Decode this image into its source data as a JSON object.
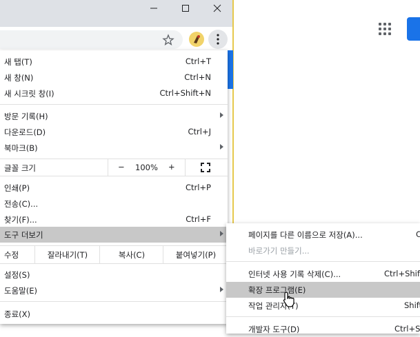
{
  "colors": {
    "accent": "#1a73e8",
    "highlight": "#c8c8c8",
    "disabled_text": "#9aa0a6"
  },
  "window": {
    "icons": [
      "minimize-icon",
      "maximize-icon",
      "close-icon"
    ]
  },
  "toolbar": {
    "icons": [
      "bookmark-star-icon",
      "extension-icon",
      "menu-kebab-icon"
    ]
  },
  "page": {
    "icons": [
      "apps-grid-icon"
    ]
  },
  "menu": {
    "new_tab": {
      "label": "새 탭(T)",
      "shortcut": "Ctrl+T"
    },
    "new_window": {
      "label": "새 창(N)",
      "shortcut": "Ctrl+N"
    },
    "incognito": {
      "label": "새 시크릿 창(I)",
      "shortcut": "Ctrl+Shift+N"
    },
    "history": {
      "label": "방문 기록(H)"
    },
    "downloads": {
      "label": "다운로드(D)",
      "shortcut": "Ctrl+J"
    },
    "bookmarks": {
      "label": "북마크(B)"
    },
    "zoom": {
      "label": "글꼴 크기",
      "minus": "−",
      "value": "100%",
      "plus": "+"
    },
    "print": {
      "label": "인쇄(P)",
      "shortcut": "Ctrl+P"
    },
    "cast": {
      "label": "전송(C)..."
    },
    "find": {
      "label": "찾기(F)...",
      "shortcut": "Ctrl+F"
    },
    "more_tools": {
      "label": "도구 더보기"
    },
    "edit": {
      "label": "수정",
      "cut": "잘라내기(T)",
      "copy": "복사(C)",
      "paste": "붙여넣기(P)"
    },
    "settings": {
      "label": "설정(S)"
    },
    "help": {
      "label": "도움말(E)"
    },
    "exit": {
      "label": "종료(X)"
    }
  },
  "submenu": {
    "save_page": {
      "label": "페이지를 다른 이름으로 저장(A)...",
      "shortcut": "C"
    },
    "create_shortcut": {
      "label": "바로가기 만들기..."
    },
    "clear_data": {
      "label": "인터넷 사용 기록 삭제(C)...",
      "shortcut": "Ctrl+Shift"
    },
    "extensions": {
      "label": "확장 프로그램(E)"
    },
    "task_manager": {
      "label": "작업 관리자(T)",
      "shortcut": "Shift"
    },
    "devtools": {
      "label": "개발자 도구(D)",
      "shortcut": "Ctrl+Sh"
    }
  }
}
